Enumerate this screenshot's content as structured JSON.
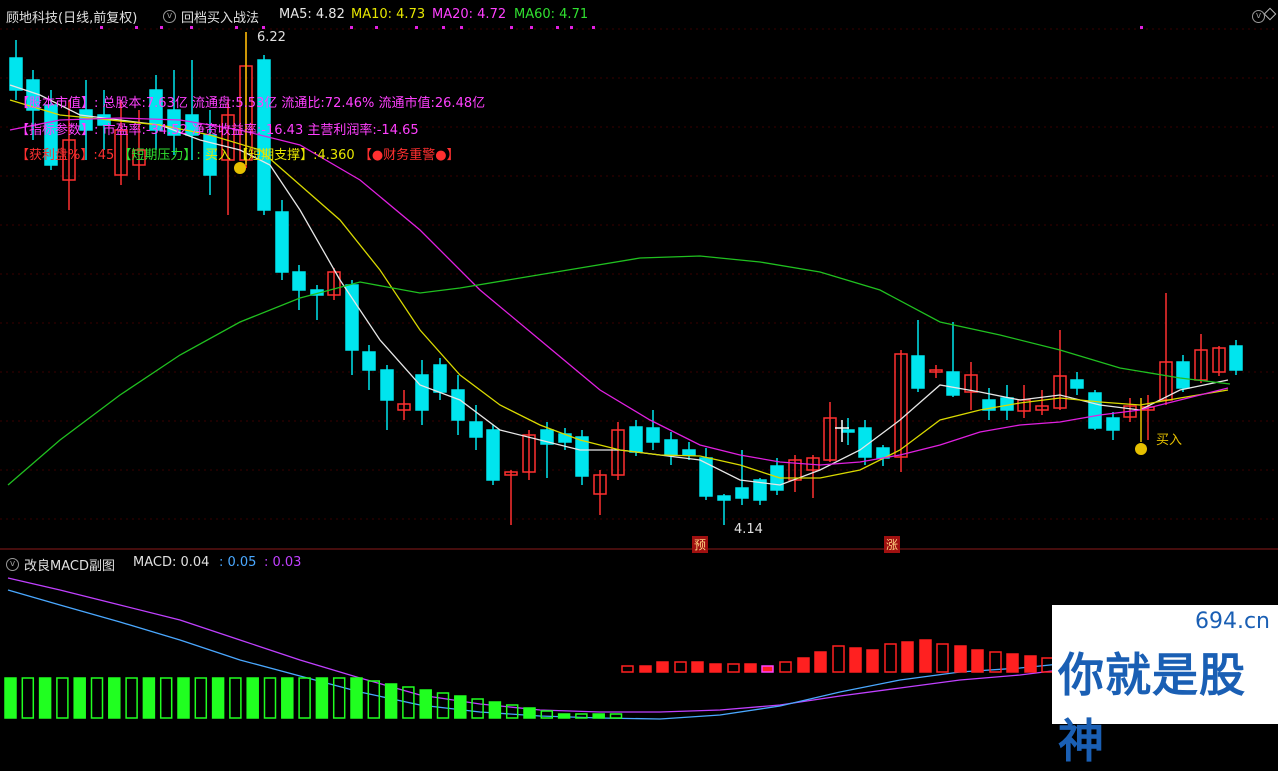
{
  "header": {
    "stock_name": "顾地科技(日线,前复权)",
    "strategy_name": "回档买入战法",
    "ma5": "MA5: 4.82",
    "ma10": "MA10: 4.73",
    "ma20": "MA20: 4.72",
    "ma60": "MA60: 4.71"
  },
  "info": {
    "line1": "【股本市值】: 总股本:7.63亿 流通盘:5.53亿 流通比:72.46% 流通市值:26.48亿",
    "line2": "【指标参数】: 市盈率:-34.52 净资收益率:-16.43 主营利润率:-14.65",
    "line3_a": "【获利盘%】:45",
    "line3_b": "【短期压力】:",
    "line3_c": "买入",
    "line3_d": "【短期支撑】:4.360",
    "line3_e": "【●财务重警●】"
  },
  "annotations": {
    "high_label": "6.22",
    "low_label": "4.14",
    "buy_label": "买入",
    "badge_yu": "预",
    "badge_zhang": "涨"
  },
  "subchart": {
    "title": "改良MACD副图",
    "macd": "MACD: 0.04",
    "dif": ": 0.05",
    "dea": ": 0.03"
  },
  "watermark": {
    "domain": "694.cn",
    "text": "你就是股神"
  },
  "colors": {
    "up": "#ff3030",
    "down": "#00e5ee",
    "ma5": "#e6e6e6",
    "ma10": "#d9d900",
    "ma20": "#e020e0",
    "ma60": "#20c020",
    "macd_up": "#ff2020",
    "macd_down": "#20ff20"
  }
}
